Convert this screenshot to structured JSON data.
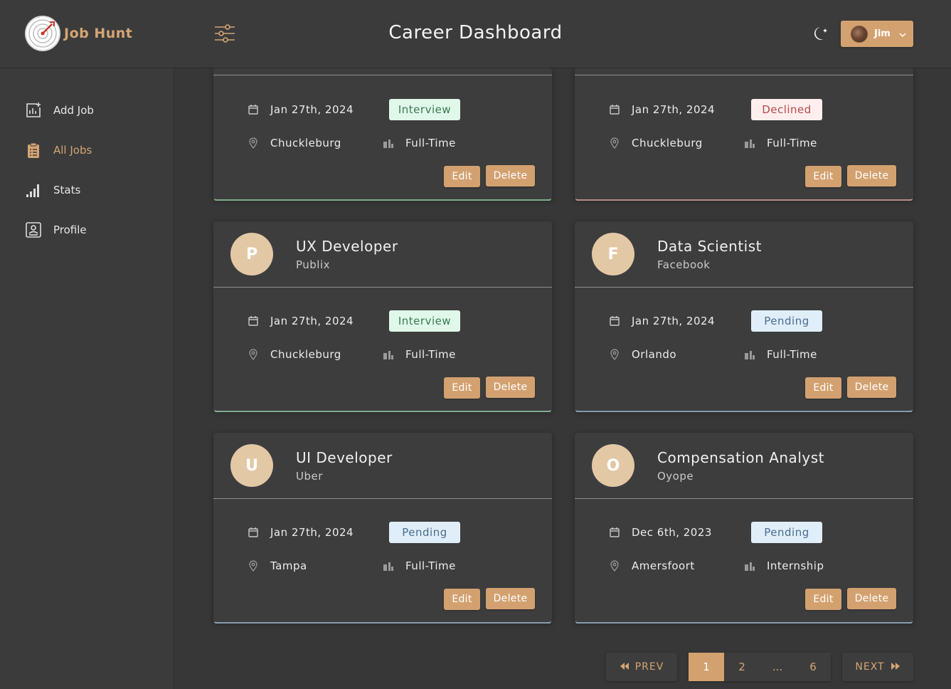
{
  "brand": {
    "name": "Job Hunt"
  },
  "header": {
    "title": "Career Dashboard",
    "user_name": "Jim"
  },
  "sidebar": {
    "items": [
      {
        "label": "Add Job",
        "icon": "add-chart-icon"
      },
      {
        "label": "All Jobs",
        "icon": "clipboard-icon",
        "active": true
      },
      {
        "label": "Stats",
        "icon": "signal-bars-icon"
      },
      {
        "label": "Profile",
        "icon": "profile-card-icon"
      }
    ]
  },
  "jobs": [
    {
      "date": "Jan 27th, 2024",
      "status": "Interview",
      "location": "Chuckleburg",
      "job_type": "Full-Time"
    },
    {
      "date": "Jan 27th, 2024",
      "status": "Declined",
      "location": "Chuckleburg",
      "job_type": "Full-Time"
    },
    {
      "letter": "P",
      "position": "UX Developer",
      "company": "Publix",
      "date": "Jan 27th, 2024",
      "status": "Interview",
      "location": "Chuckleburg",
      "job_type": "Full-Time"
    },
    {
      "letter": "F",
      "position": "Data Scientist",
      "company": "Facebook",
      "date": "Jan 27th, 2024",
      "status": "Pending",
      "location": "Orlando",
      "job_type": "Full-Time"
    },
    {
      "letter": "U",
      "position": "UI Developer",
      "company": "Uber",
      "date": "Jan 27th, 2024",
      "status": "Pending",
      "location": "Tampa",
      "job_type": "Full-Time"
    },
    {
      "letter": "O",
      "position": "Compensation Analyst",
      "company": "Oyope",
      "date": "Dec 6th, 2023",
      "status": "Pending",
      "location": "Amersfoort",
      "job_type": "Internship"
    }
  ],
  "actions": {
    "edit": "Edit",
    "delete": "Delete"
  },
  "pagination": {
    "prev": "PREV",
    "next": "NEXT",
    "pages": [
      "1",
      "2",
      "...",
      "6"
    ],
    "current": "1"
  },
  "colors": {
    "accent": "#d3a170",
    "background": "#373737",
    "card": "#3d3d3d"
  }
}
